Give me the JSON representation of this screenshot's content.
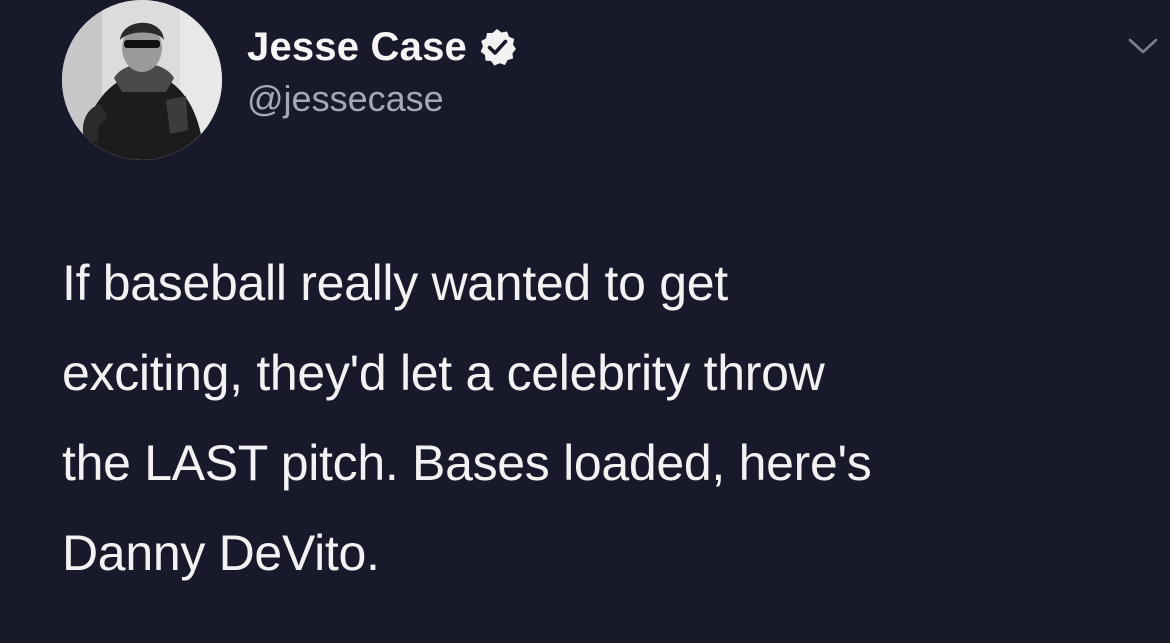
{
  "tweet": {
    "author": {
      "display_name": "Jesse Case",
      "handle": "@jessecase",
      "verified": true
    },
    "text_lines": [
      "If baseball really wanted to get",
      "exciting, they'd let a celebrity throw",
      "the LAST pitch. Bases loaded, here's",
      "Danny DeVito."
    ]
  },
  "icons": {
    "verified": "verified-badge-icon",
    "menu": "chevron-down-icon"
  },
  "colors": {
    "background": "#181a2b",
    "text": "#f2f2f2",
    "handle": "#a6a8b6"
  }
}
